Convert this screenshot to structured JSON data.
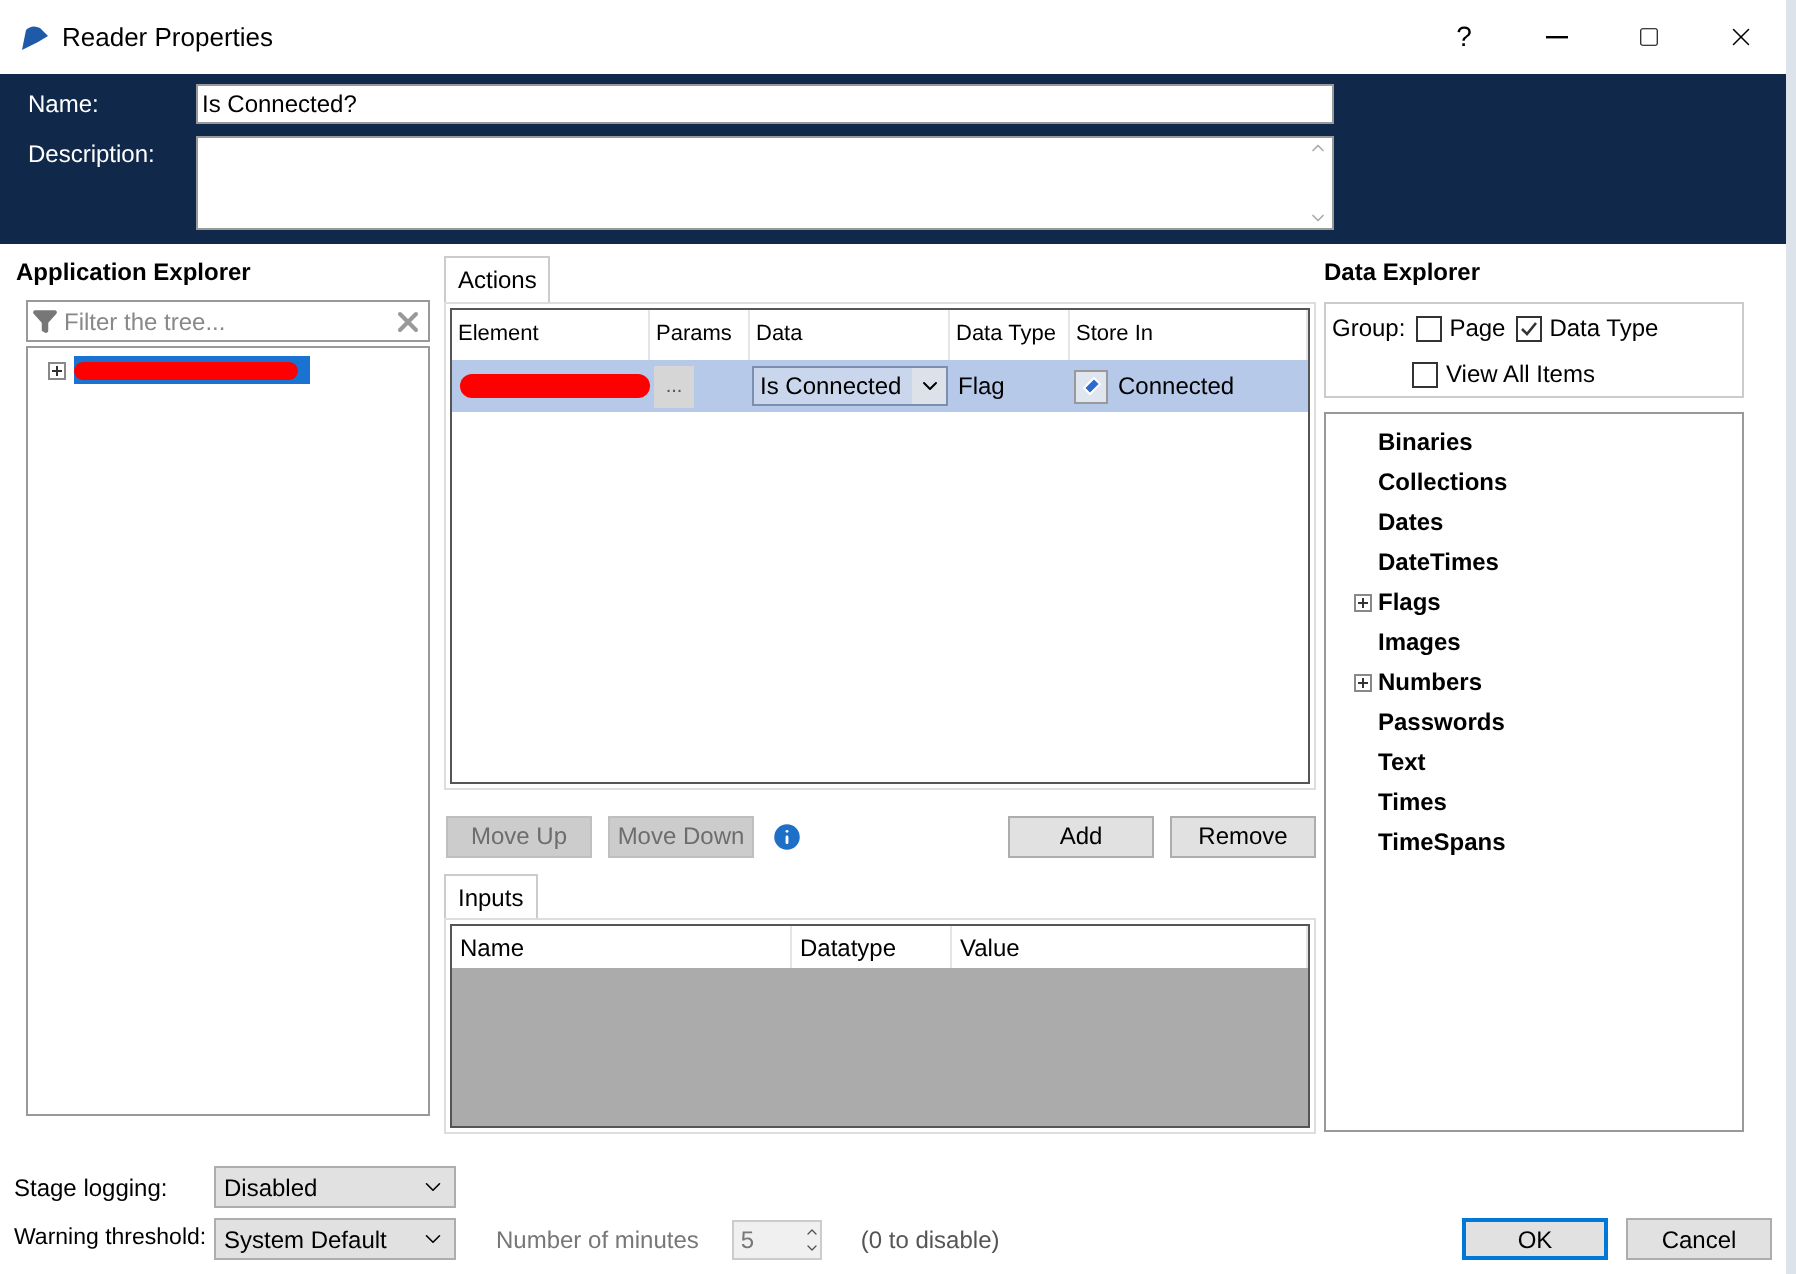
{
  "window": {
    "title": "Reader Properties",
    "controls": [
      "?"
    ]
  },
  "header": {
    "name_label": "Name:",
    "name_value": "Is Connected?",
    "description_label": "Description:"
  },
  "application_explorer": {
    "title": "Application Explorer",
    "filter": {
      "placeholder": "Filter the tree..."
    }
  },
  "actions": {
    "tab": {
      "label": "Actions",
      "selected": true
    },
    "columns": [
      "Element",
      "Params",
      "Data",
      "Data Type",
      "Store In"
    ],
    "rows": [
      {
        "selected": true,
        "params": "...",
        "data": "Is Connected",
        "data_type": "Flag",
        "store_in": "Connected"
      }
    ],
    "buttons": [
      {
        "label": "Move Up",
        "disabled": true
      },
      {
        "label": "Move Down",
        "disabled": true
      },
      {
        "label": "Add",
        "disabled": false
      },
      {
        "label": "Remove",
        "disabled": false
      }
    ]
  },
  "inputs": {
    "tab": {
      "label": "Inputs",
      "selected": true
    },
    "columns": [
      "Name",
      "Datatype",
      "Value"
    ]
  },
  "data_explorer": {
    "title": "Data Explorer",
    "group_label": "Group:",
    "options": [
      {
        "label": "Page",
        "checked": false
      },
      {
        "label": "Data Type",
        "checked": true
      },
      {
        "label": "View All Items",
        "checked": false
      }
    ],
    "items": [
      {
        "label": "Binaries",
        "kind": "leaf"
      },
      {
        "label": "Collections",
        "kind": "leaf"
      },
      {
        "label": "Dates",
        "kind": "leaf"
      },
      {
        "label": "DateTimes",
        "kind": "leaf"
      },
      {
        "label": "Flags",
        "kind": "group"
      },
      {
        "label": "Images",
        "kind": "leaf"
      },
      {
        "label": "Numbers",
        "kind": "group"
      },
      {
        "label": "Passwords",
        "kind": "leaf"
      },
      {
        "label": "Text",
        "kind": "leaf"
      },
      {
        "label": "Times",
        "kind": "leaf"
      },
      {
        "label": "TimeSpans",
        "kind": "leaf"
      }
    ]
  },
  "footer": {
    "stage_logging_label": "Stage logging:",
    "stage_logging_value": "Disabled",
    "warning_label": "Warning threshold:",
    "warning_value": "System Default",
    "minutes_label": "Number of minutes",
    "minutes_value": "5",
    "minutes_disabled": true,
    "minutes_hint": "(0 to disable)",
    "buttons": [
      {
        "label": "OK",
        "default": true
      },
      {
        "label": "Cancel",
        "default": false
      }
    ]
  }
}
